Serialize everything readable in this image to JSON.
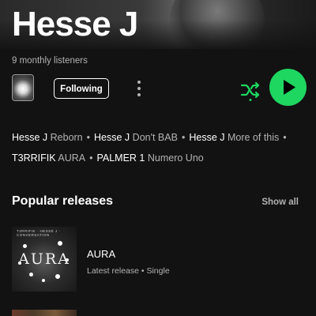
{
  "header": {
    "artist_name": "Hesse J",
    "monthly_listeners": "9 monthly listeners"
  },
  "actions": {
    "follow_label": "Following",
    "more_icon": "more-vertical-icon",
    "shuffle_icon": "shuffle-icon",
    "play_icon": "play-icon",
    "accent_color": "#1ed760"
  },
  "featured_links": {
    "row1": [
      {
        "artist": "Hesse J",
        "title": "Reborn"
      },
      {
        "artist": "Hesse J",
        "title": "Don't BAB"
      },
      {
        "artist": "Hesse J",
        "title": "More of this"
      }
    ],
    "row2": [
      {
        "artist": "T3RRIFIK",
        "title": "AURA"
      },
      {
        "artist": "PALMER 1",
        "title": "Numero Uno"
      }
    ],
    "separator": "•"
  },
  "popular_releases": {
    "heading": "Popular releases",
    "show_all": "Show all",
    "items": [
      {
        "cover_text": "AURA",
        "cover_topline": "T3RRIFIK · HESSE J · CONVERSATION",
        "title": "AURA",
        "subtitle": "Latest release • Single"
      }
    ]
  }
}
